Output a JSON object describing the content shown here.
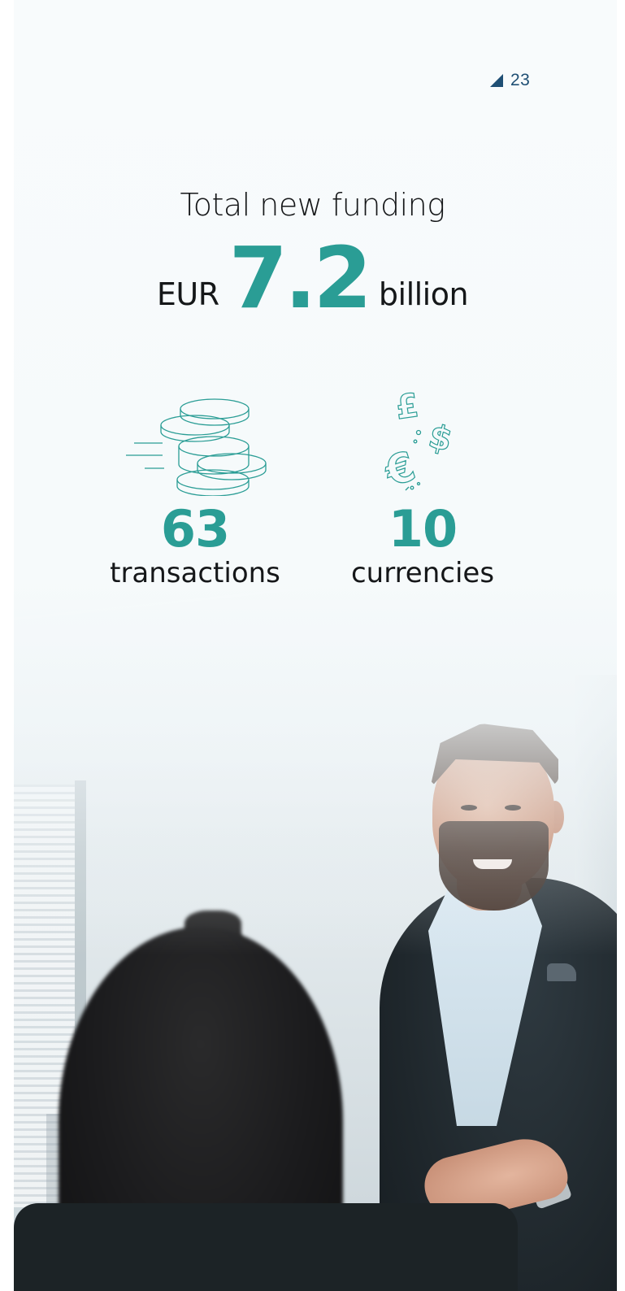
{
  "page": {
    "number": "23"
  },
  "headline": {
    "title": "Total new funding",
    "currency": "EUR",
    "value": "7.2",
    "unit": "billion"
  },
  "stats": [
    {
      "icon": "coin-stack-icon",
      "value": "63",
      "label": "transactions"
    },
    {
      "icon": "currency-symbols-icon",
      "value": "10",
      "label": "currencies"
    }
  ],
  "colors": {
    "accent": "#2a9d95",
    "text": "#151719",
    "page_number": "#1f4f74"
  }
}
